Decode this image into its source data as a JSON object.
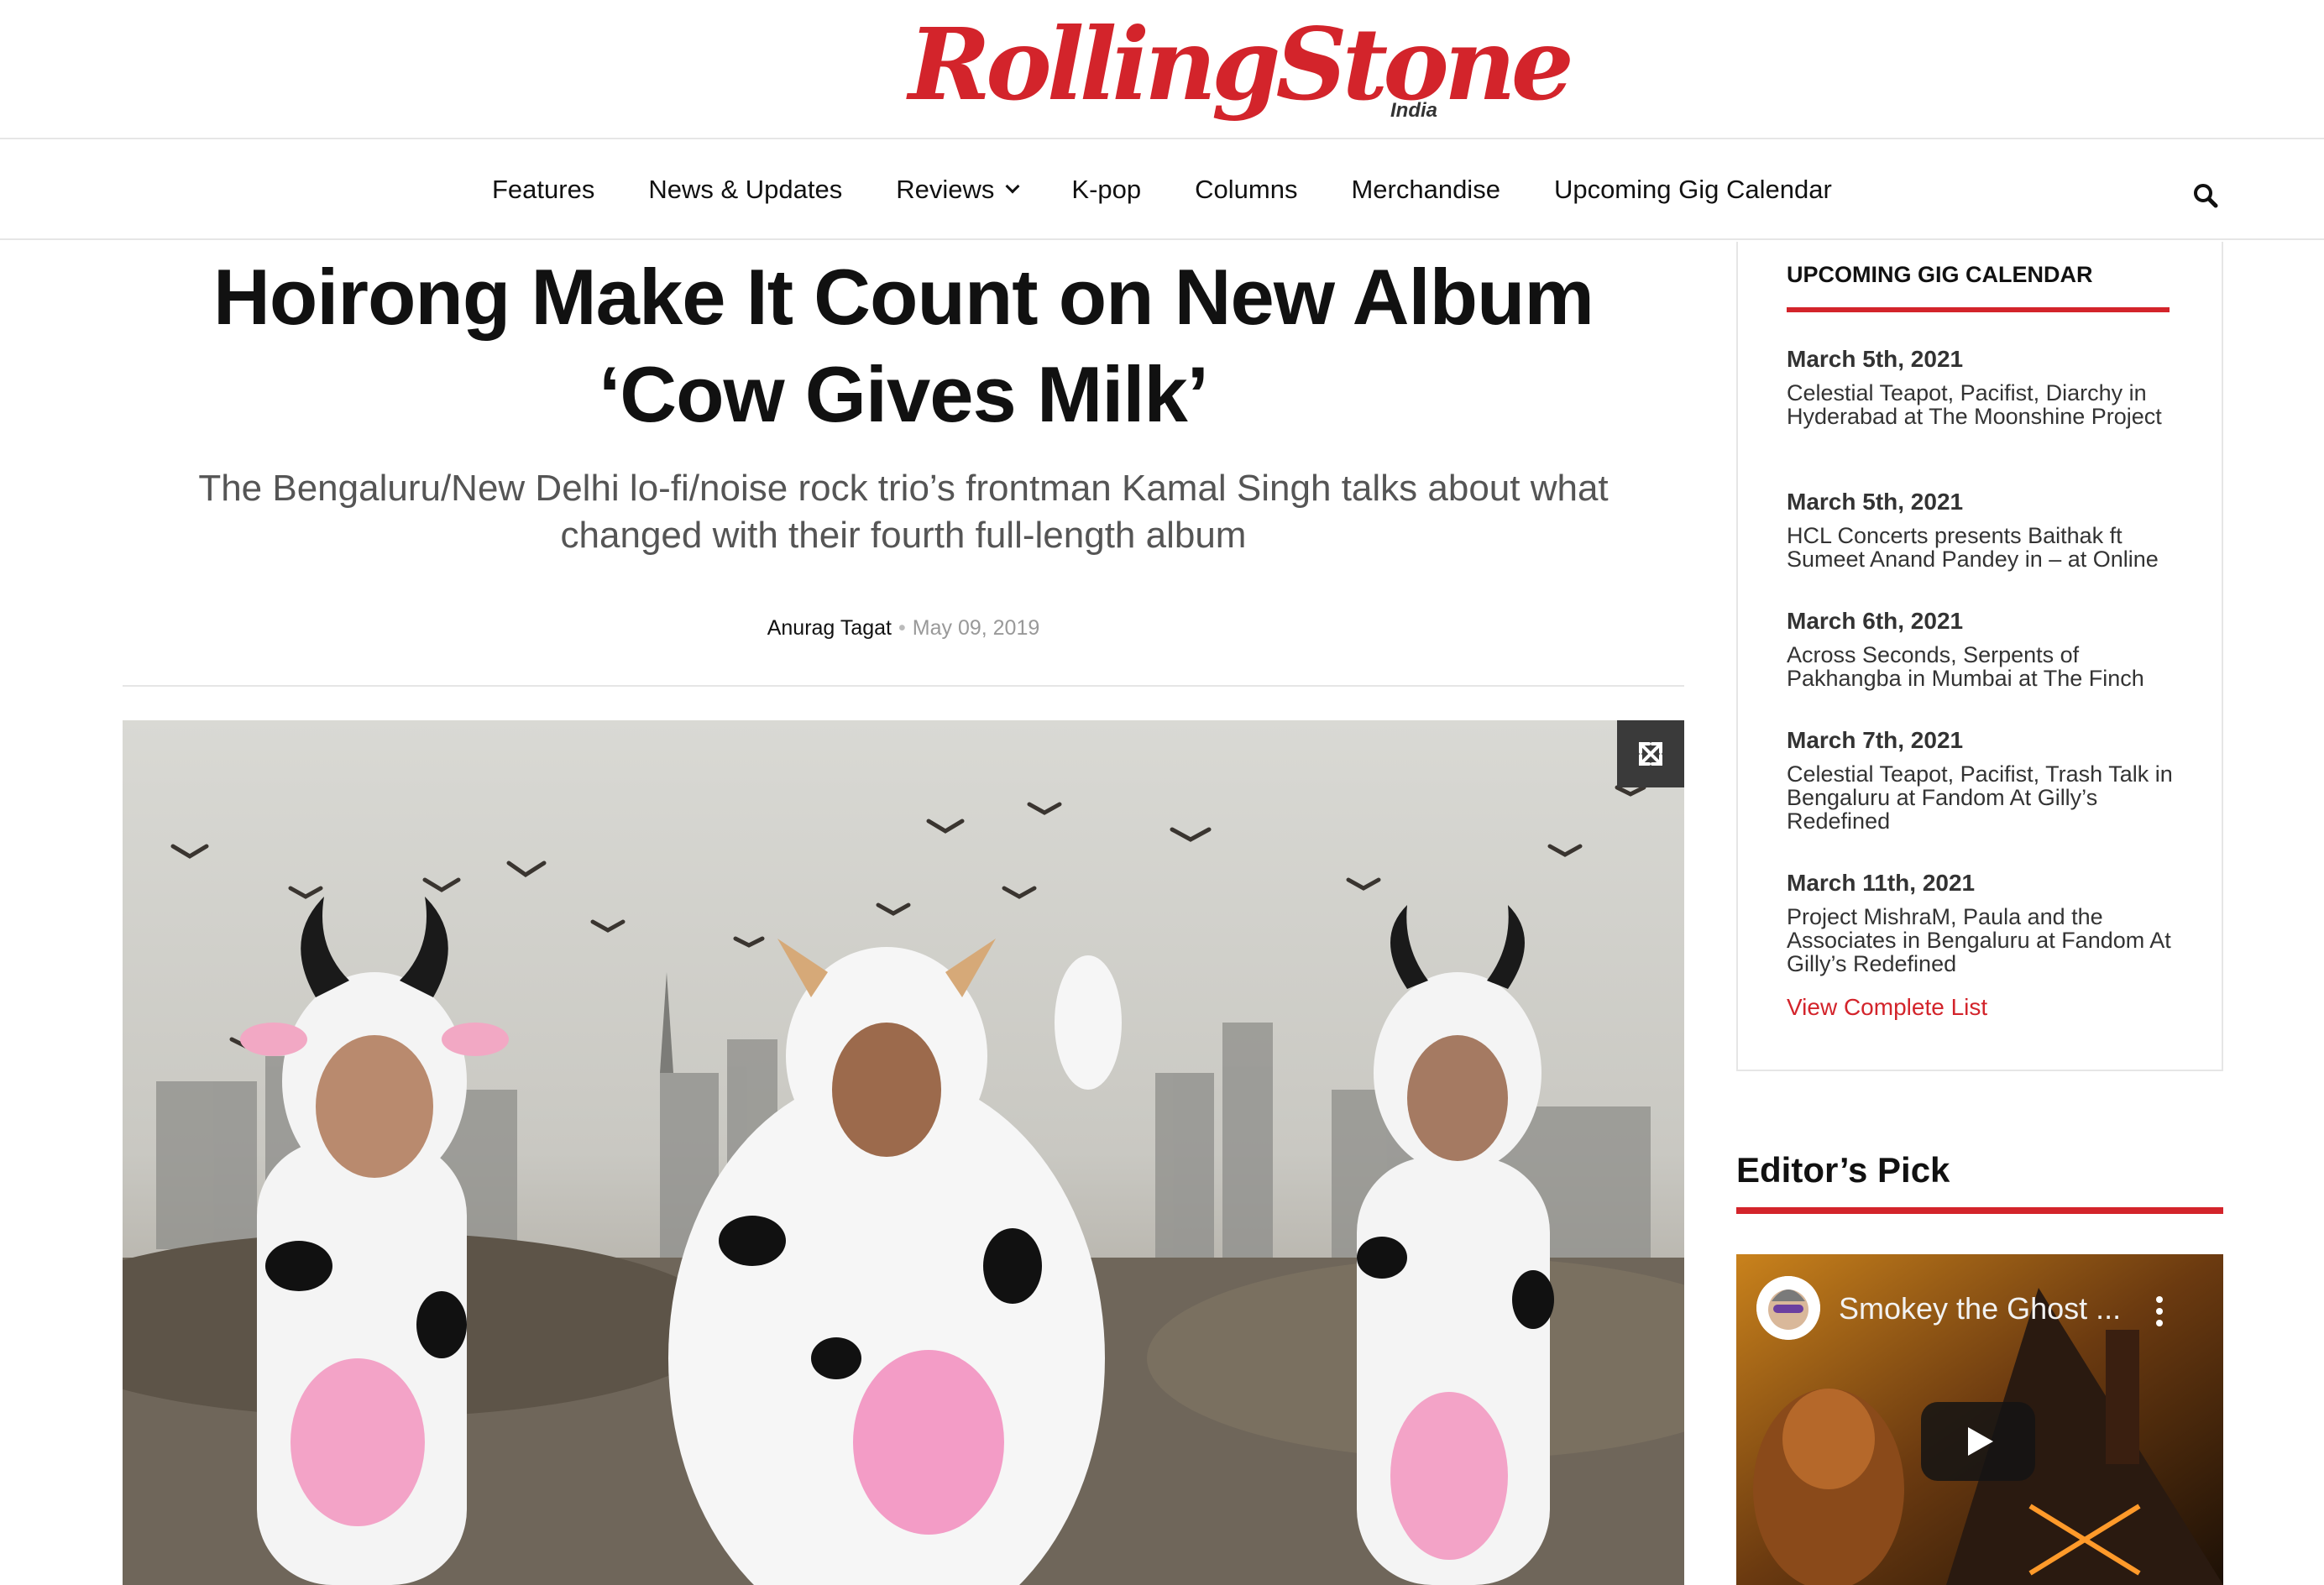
{
  "site": {
    "logo_main": "RollingStone",
    "logo_sub": "India"
  },
  "nav": {
    "items": [
      {
        "label": "Features"
      },
      {
        "label": "News & Updates"
      },
      {
        "label": "Reviews",
        "has_dropdown": true
      },
      {
        "label": "K-pop"
      },
      {
        "label": "Columns"
      },
      {
        "label": "Merchandise"
      },
      {
        "label": "Upcoming Gig Calendar"
      }
    ],
    "search_icon": "search-icon"
  },
  "article": {
    "headline": "Hoirong Make It Count on New Album ‘Cow Gives Milk’",
    "subhead": "The Bengaluru/New Delhi lo-fi/noise rock trio’s frontman Kamal Singh talks about what changed with their fourth full-length album",
    "author": "Anurag Tagat",
    "separator": "•",
    "date": "May 09, 2019",
    "expand_icon": "expand-icon"
  },
  "sidebar": {
    "gig_calendar": {
      "title": "UPCOMING GIG CALENDAR",
      "events": [
        {
          "date": "March 5th, 2021",
          "text": "Celestial Teapot, Pacifist, Diarchy in Hyderabad at The Moonshine Project"
        },
        {
          "date": "March 5th, 2021",
          "text": "HCL Concerts presents Baithak ft Sumeet Anand Pandey in – at Online"
        },
        {
          "date": "March 6th, 2021",
          "text": "Across Seconds, Serpents of Pakhangba in Mumbai at The Finch"
        },
        {
          "date": "March 7th, 2021",
          "text": "Celestial Teapot, Pacifist, Trash Talk in Bengaluru at Fandom At Gilly’s Redefined"
        },
        {
          "date": "March 11th, 2021",
          "text": "Project MishraM, Paula and the Associates in Bengaluru at Fandom At Gilly’s Redefined"
        }
      ],
      "view_all": "View Complete List"
    },
    "editors_pick": {
      "title": "Editor’s Pick",
      "video_title": "Smokey the Ghost ...",
      "play_icon": "play-icon",
      "menu_icon": "more-vert-icon"
    }
  },
  "colors": {
    "brand_red": "#d3242b",
    "text_dark": "#111111",
    "text_muted": "#555555",
    "divider": "#e6e6e6"
  }
}
